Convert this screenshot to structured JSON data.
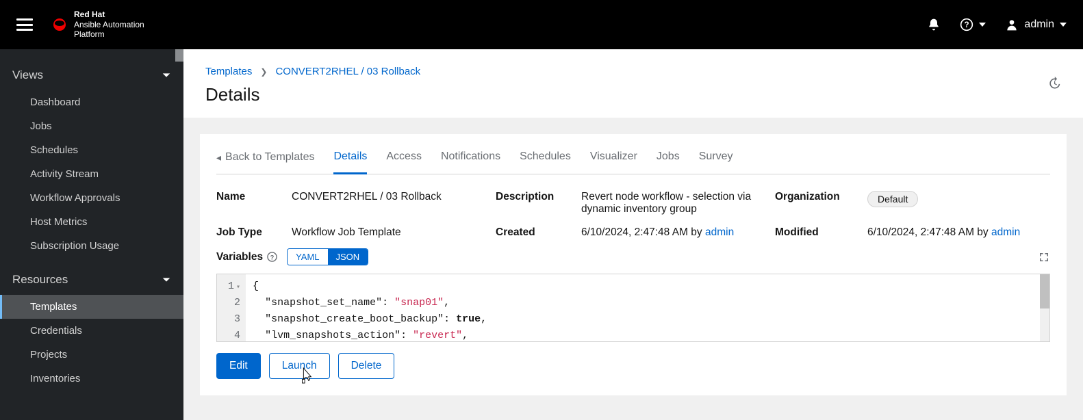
{
  "header": {
    "brand_top": "Red Hat",
    "brand_line1": "Ansible Automation",
    "brand_line2": "Platform",
    "username": "admin"
  },
  "sidebar": {
    "views_label": "Views",
    "views_items": [
      "Dashboard",
      "Jobs",
      "Schedules",
      "Activity Stream",
      "Workflow Approvals",
      "Host Metrics",
      "Subscription Usage"
    ],
    "resources_label": "Resources",
    "resources_items": [
      "Templates",
      "Credentials",
      "Projects",
      "Inventories"
    ]
  },
  "breadcrumb": {
    "root": "Templates",
    "current": "CONVERT2RHEL / 03 Rollback"
  },
  "page": {
    "title": "Details"
  },
  "tabs": {
    "back": "Back to Templates",
    "items": [
      "Details",
      "Access",
      "Notifications",
      "Schedules",
      "Visualizer",
      "Jobs",
      "Survey"
    ]
  },
  "details": {
    "name_label": "Name",
    "name_value": "CONVERT2RHEL / 03 Rollback",
    "desc_label": "Description",
    "desc_value": "Revert node workflow - selection via dynamic inventory group",
    "org_label": "Organization",
    "org_value": "Default",
    "jobtype_label": "Job Type",
    "jobtype_value": "Workflow Job Template",
    "created_label": "Created",
    "created_value": "6/10/2024, 2:47:48 AM by ",
    "created_user": "admin",
    "modified_label": "Modified",
    "modified_value": "6/10/2024, 2:47:48 AM by ",
    "modified_user": "admin",
    "variables_label": "Variables",
    "yaml_btn": "YAML",
    "json_btn": "JSON"
  },
  "editor": {
    "lines": [
      {
        "n": "1",
        "text": "{"
      },
      {
        "n": "2",
        "key": "\"snapshot_set_name\"",
        "val": "\"snap01\"",
        "trail": ","
      },
      {
        "n": "3",
        "key": "\"snapshot_create_boot_backup\"",
        "kw": "true",
        "trail": ","
      },
      {
        "n": "4",
        "key": "\"lvm_snapshots_action\"",
        "val": "\"revert\"",
        "trail": ","
      }
    ]
  },
  "actions": {
    "edit": "Edit",
    "launch": "Launch",
    "delete": "Delete"
  }
}
